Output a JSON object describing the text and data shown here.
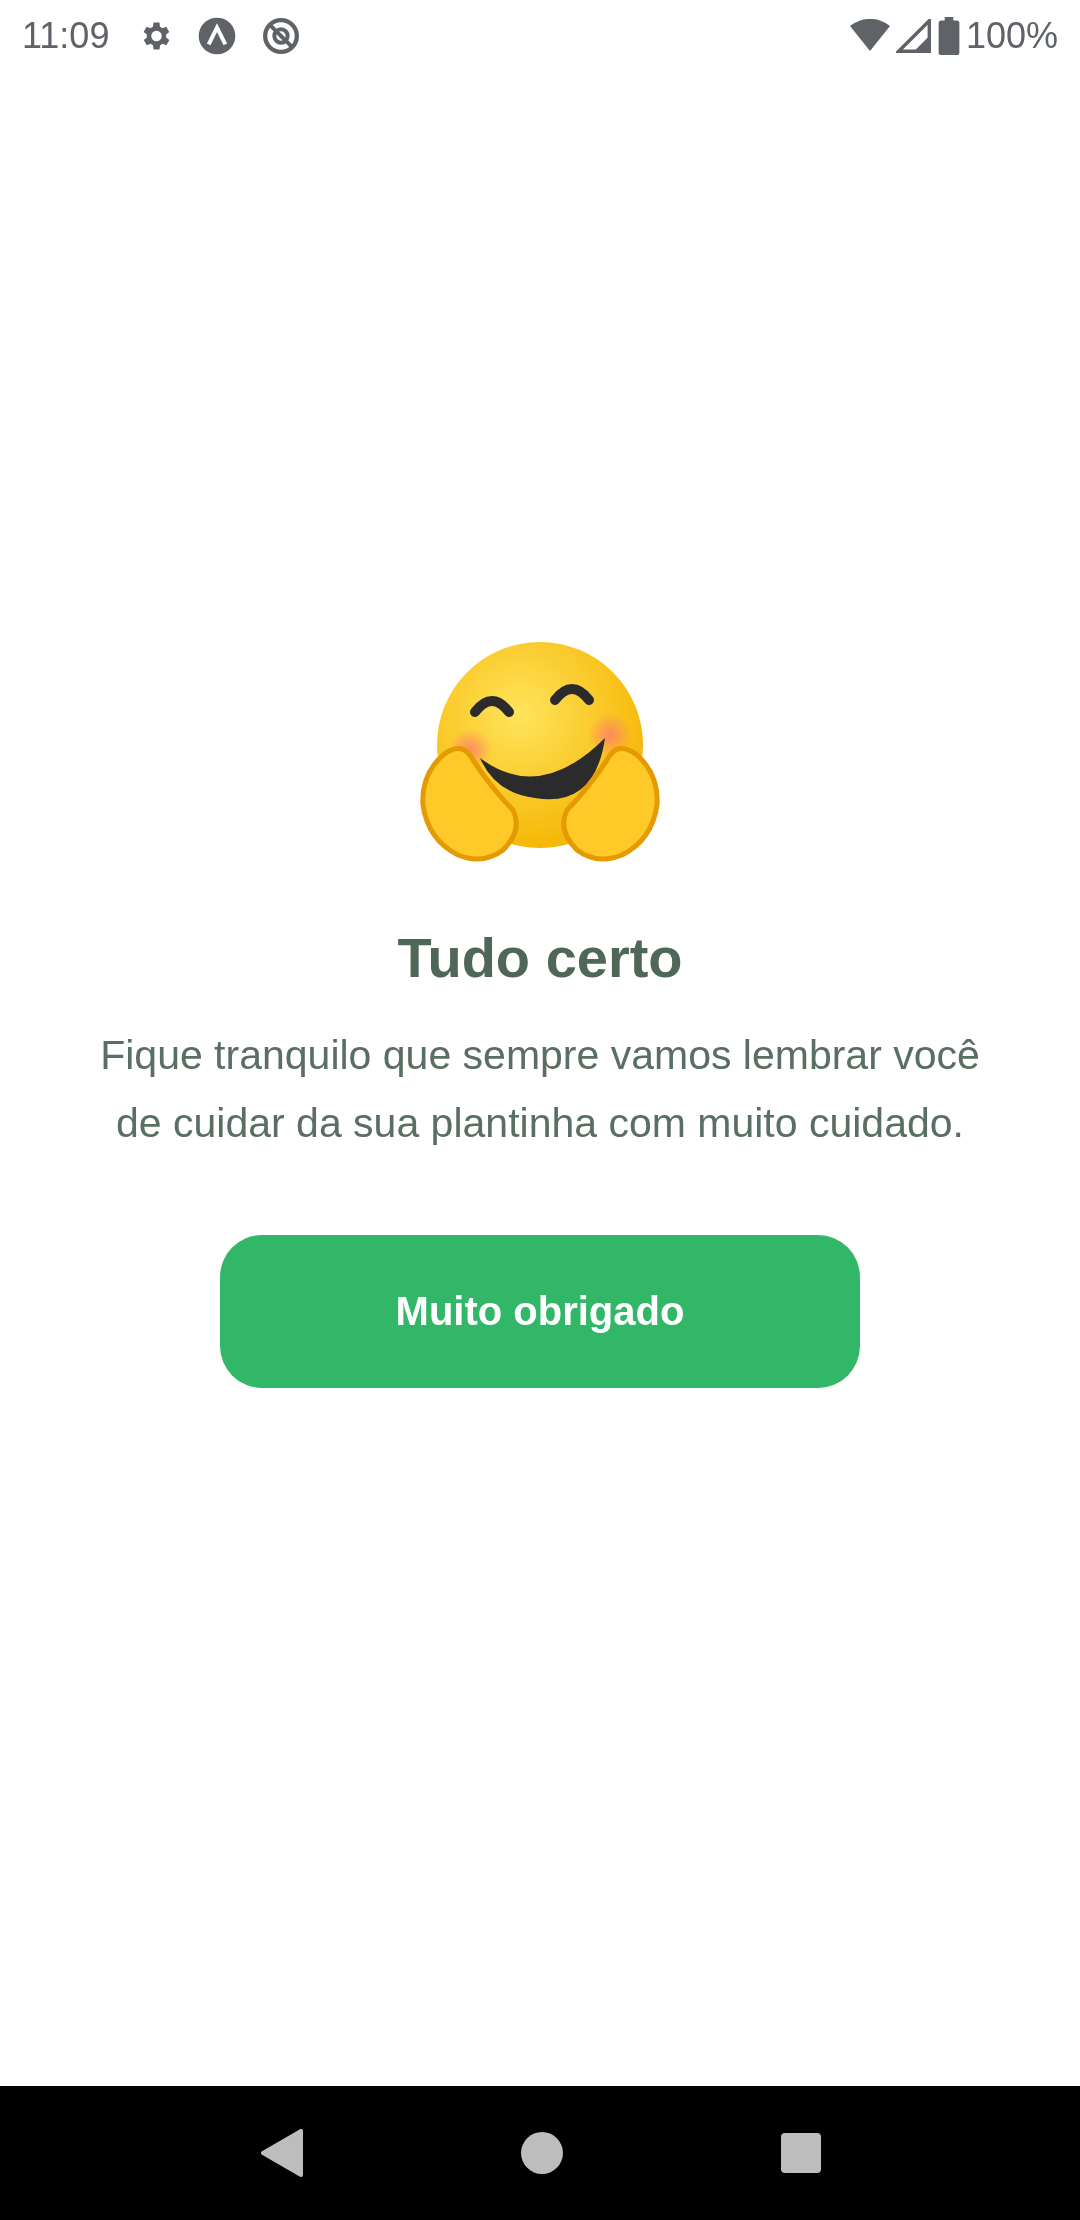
{
  "status_bar": {
    "time": "11:09",
    "battery": "100%"
  },
  "title": "Tudo certo",
  "message": "Fique tranquilo que sempre vamos lembrar você de cuidar da sua plantinha com muito cuidado.",
  "button": {
    "label": "Muito obrigado"
  }
}
